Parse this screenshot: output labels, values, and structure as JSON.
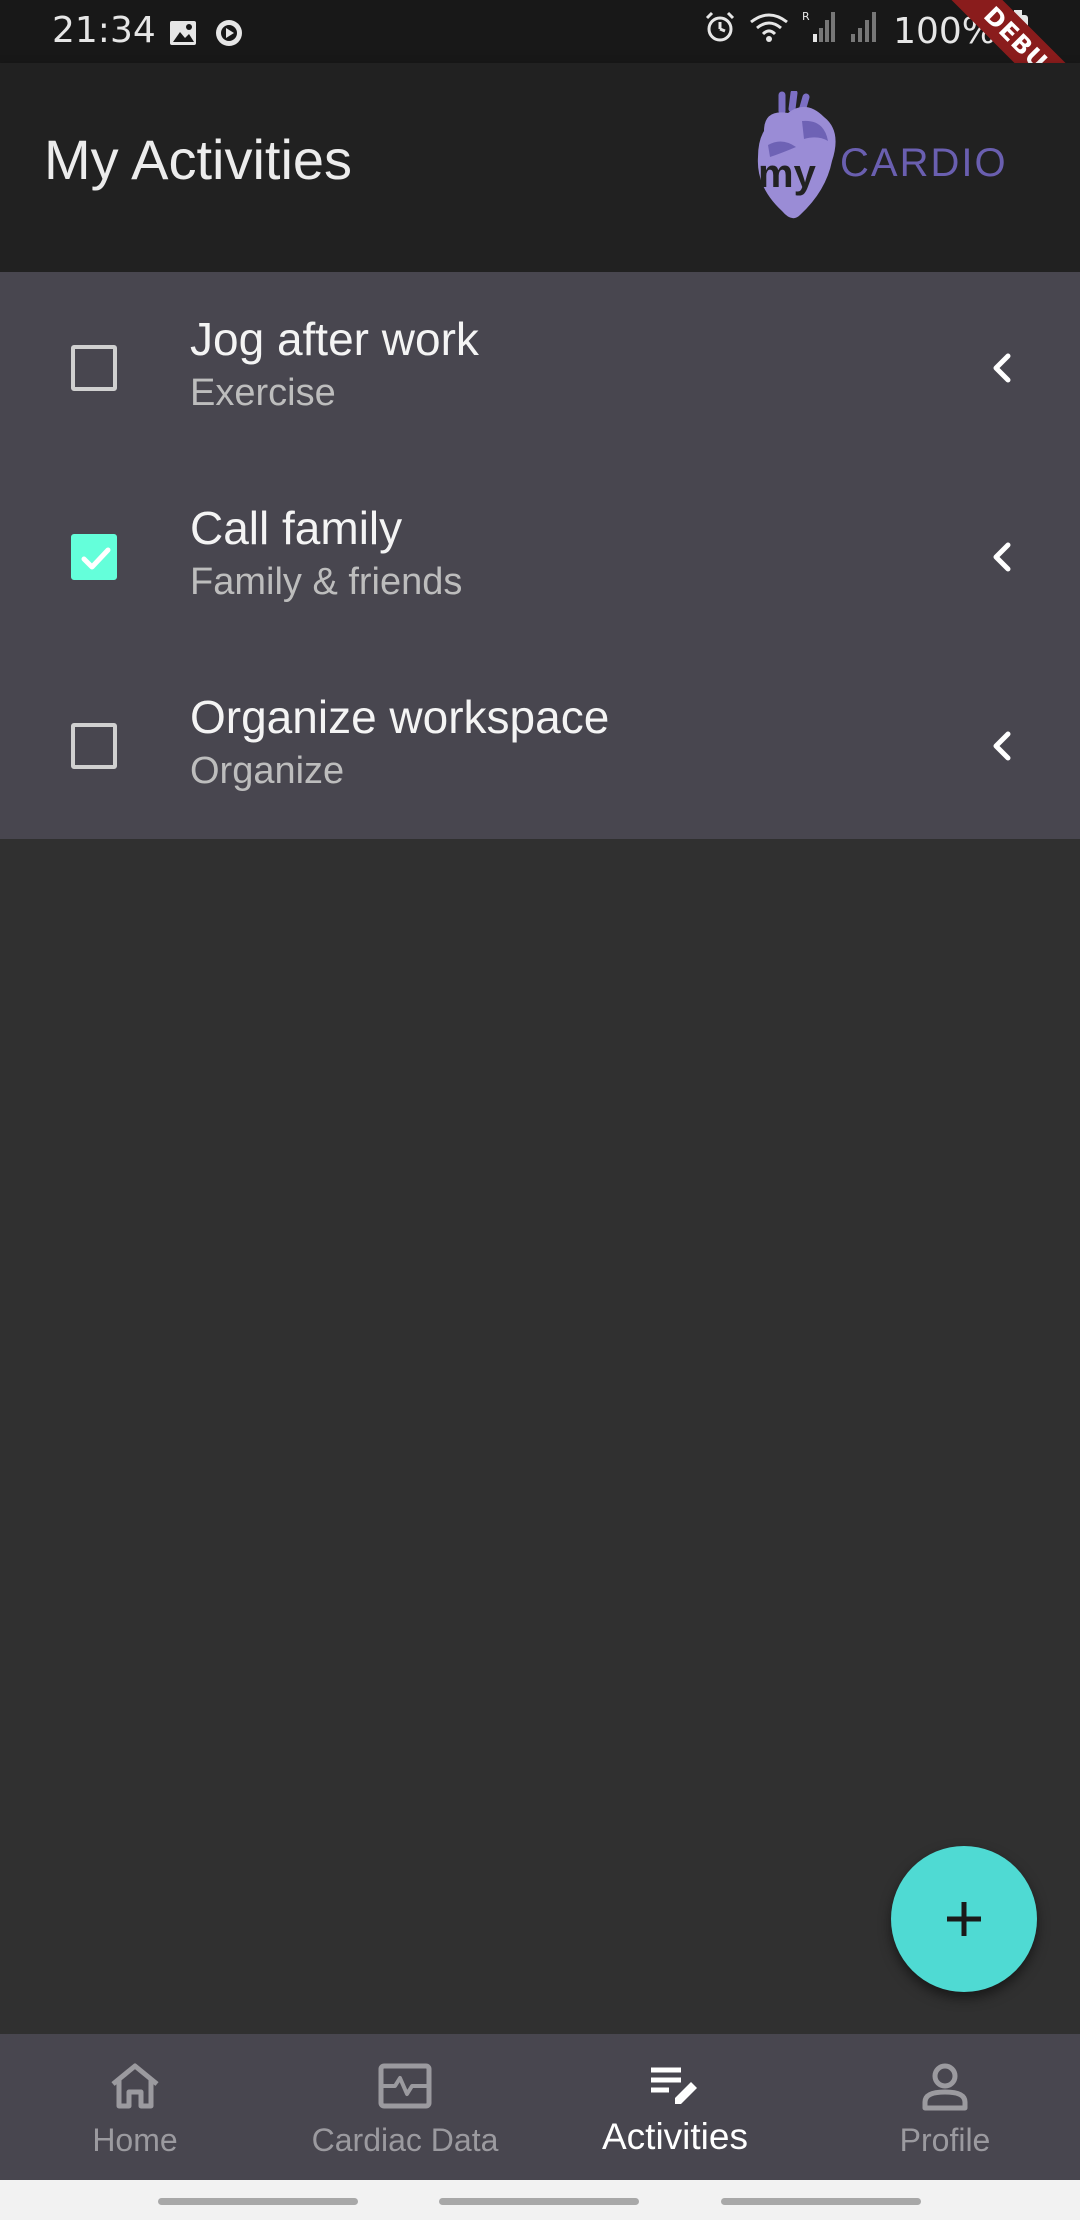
{
  "status_bar": {
    "time": "21:34",
    "battery": "100%",
    "debug_label": "DEBUG"
  },
  "app_bar": {
    "title": "My Activities",
    "logo": {
      "prefix": "my",
      "name": "CARDIO"
    }
  },
  "activities": [
    {
      "title": "Jog after work",
      "category": "Exercise",
      "checked": false
    },
    {
      "title": "Call family",
      "category": "Family & friends",
      "checked": true
    },
    {
      "title": "Organize workspace",
      "category": "Organize",
      "checked": false
    }
  ],
  "fab": {
    "icon": "plus-icon"
  },
  "bottom_nav": {
    "items": [
      {
        "label": "Home",
        "icon": "home-icon",
        "active": false
      },
      {
        "label": "Cardiac Data",
        "icon": "cardiac-monitor-icon",
        "active": false
      },
      {
        "label": "Activities",
        "icon": "notes-edit-icon",
        "active": true
      },
      {
        "label": "Profile",
        "icon": "person-icon",
        "active": false
      }
    ]
  },
  "colors": {
    "accent": "#64ffda",
    "fab": "#4fdad3",
    "brand": "#6a5fb0",
    "list_background": "#48464f",
    "app_bar": "#212121",
    "body": "#303030"
  }
}
